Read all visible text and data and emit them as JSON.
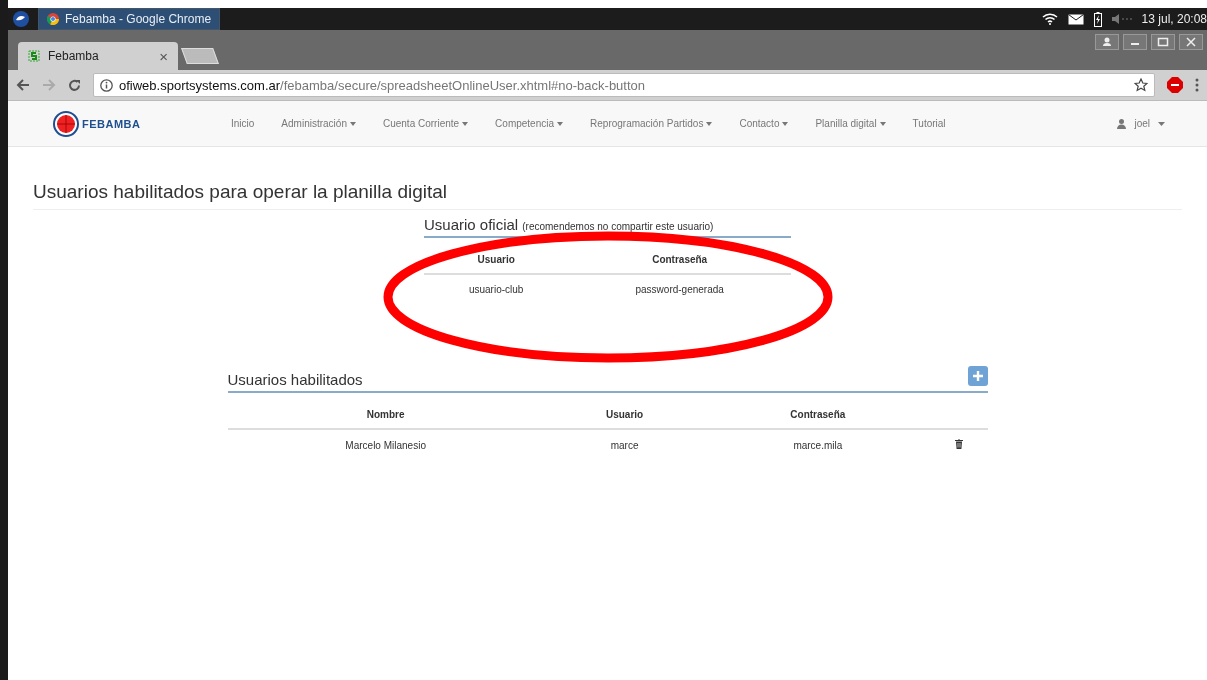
{
  "os_bar": {
    "window_button": "Febamba - Google Chrome",
    "clock": "13 jul, 20:08"
  },
  "browser": {
    "tab": {
      "title": "Febamba",
      "close": "×"
    },
    "url": {
      "host": "ofiweb.sportsystems.com.ar",
      "path": "/febamba/secure/spreadsheetOnlineUser.xhtml#no-back-button"
    }
  },
  "nav": {
    "logo": "FEBAMBA",
    "items": [
      {
        "label": "Inicio",
        "dropdown": false
      },
      {
        "label": "Administración",
        "dropdown": true
      },
      {
        "label": "Cuenta Corriente",
        "dropdown": true
      },
      {
        "label": "Competencia",
        "dropdown": true
      },
      {
        "label": "Reprogramación Partidos",
        "dropdown": true
      },
      {
        "label": "Contacto",
        "dropdown": true
      },
      {
        "label": "Planilla digital",
        "dropdown": true
      },
      {
        "label": "Tutorial",
        "dropdown": false
      }
    ],
    "user": "joel"
  },
  "page": {
    "title": "Usuarios habilitados para operar la planilla digital",
    "official": {
      "heading": "Usuario oficial",
      "note": "(recomendemos no compartir este usuario)",
      "columns": [
        "Usuario",
        "Contraseña"
      ],
      "rows": [
        [
          "usuario-club",
          "password-generada"
        ]
      ]
    },
    "enabled": {
      "heading": "Usuarios habilitados",
      "columns": [
        "Nombre",
        "Usuario",
        "Contraseña"
      ],
      "rows": [
        [
          "Marcelo Milanesio",
          "marce",
          "marce.mila"
        ]
      ]
    }
  }
}
